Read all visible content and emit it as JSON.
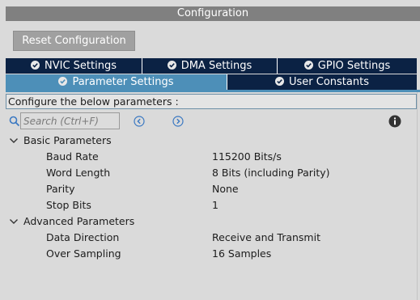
{
  "window": {
    "title": "Configuration"
  },
  "toolbar": {
    "reset_label": "Reset Configuration"
  },
  "tabs": [
    {
      "label": "NVIC Settings",
      "active": false
    },
    {
      "label": "DMA Settings",
      "active": false
    },
    {
      "label": "GPIO Settings",
      "active": false
    },
    {
      "label": "Parameter Settings",
      "active": true
    },
    {
      "label": "User Constants",
      "active": false
    }
  ],
  "panel": {
    "header": "Configure the below parameters :",
    "search": {
      "placeholder": "Search (Ctrl+F)",
      "value": ""
    },
    "icons": {
      "search": "search-icon",
      "prev": "chevron-left-circle-icon",
      "next": "chevron-right-circle-icon",
      "info": "info-icon"
    }
  },
  "groups": [
    {
      "label": "Basic Parameters",
      "expanded": true,
      "params": [
        {
          "name": "Baud Rate",
          "value": "115200 Bits/s"
        },
        {
          "name": "Word Length",
          "value": "8 Bits (including Parity)"
        },
        {
          "name": "Parity",
          "value": "None"
        },
        {
          "name": "Stop Bits",
          "value": "1"
        }
      ]
    },
    {
      "label": "Advanced Parameters",
      "expanded": true,
      "params": [
        {
          "name": "Data Direction",
          "value": "Receive and Transmit"
        },
        {
          "name": "Over Sampling",
          "value": "16 Samples"
        }
      ]
    }
  ],
  "colors": {
    "tab_dark": "#0b2244",
    "tab_active": "#4d8fb8",
    "background": "#dadada",
    "title_bar": "#808080"
  }
}
